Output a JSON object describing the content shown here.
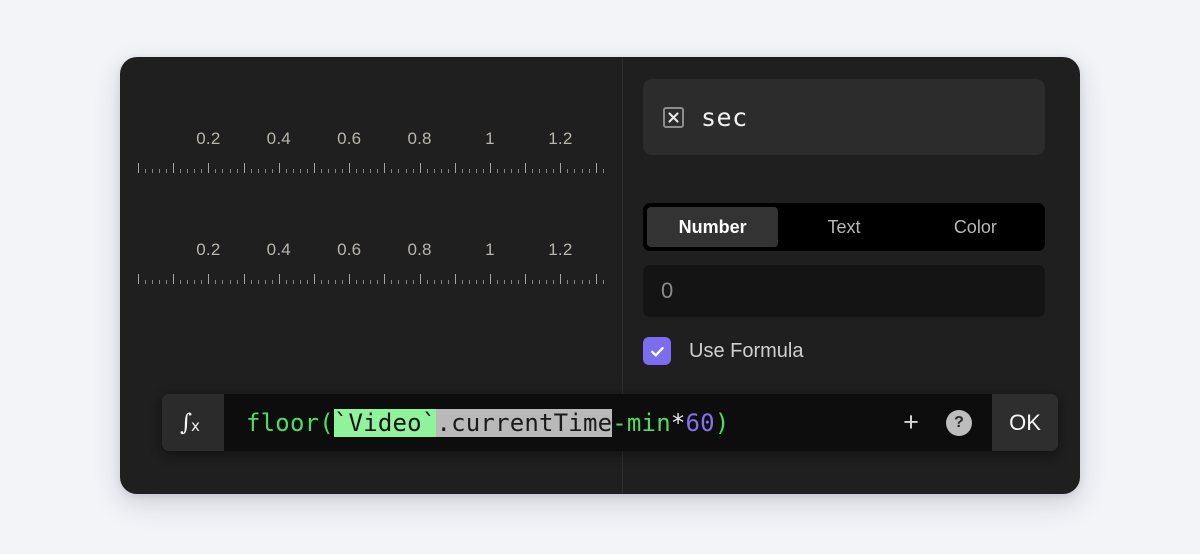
{
  "page": {
    "background_color": "#f3f4f8",
    "card_background": "#1f1f1f"
  },
  "left_pane": {
    "rulers": [
      {
        "name": "ruler-top",
        "tick_labels": [
          "0.2",
          "0.4",
          "0.6",
          "0.8",
          "1",
          "1.2"
        ],
        "minor_tick_step": 0.02,
        "major_tick_step": 0.1,
        "range_start": 0.0,
        "range_end": 1.32
      },
      {
        "name": "ruler-bottom",
        "tick_labels": [
          "0.2",
          "0.4",
          "0.6",
          "0.8",
          "1",
          "1.2"
        ],
        "minor_tick_step": 0.02,
        "major_tick_step": 0.1,
        "range_start": 0.0,
        "range_end": 1.32
      }
    ]
  },
  "right_pane": {
    "unit_field": {
      "icon": "boxed-x-icon",
      "label": "sec"
    },
    "type_tabs": {
      "options": [
        "Number",
        "Text",
        "Color"
      ],
      "active": "Number",
      "active_background": "#333333"
    },
    "value_field": {
      "value": "0"
    },
    "use_formula": {
      "label": "Use Formula",
      "checked": true,
      "accent_color": "#7c6cf0",
      "check_icon": "checkmark-icon"
    }
  },
  "formula_bar": {
    "fx_icon": "function-fx-icon",
    "expression": "floor(`Video`.currentTime-min*60)",
    "tokens": [
      {
        "text": "floor",
        "style": "fn"
      },
      {
        "text": "(",
        "style": "paren"
      },
      {
        "text": "`Video`",
        "style": "ref-highlight"
      },
      {
        "text": ".currentTime",
        "style": "selection"
      },
      {
        "text": "-min",
        "style": "op"
      },
      {
        "text": "*",
        "style": "star"
      },
      {
        "text": "60",
        "style": "num"
      },
      {
        "text": ")",
        "style": "paren"
      }
    ],
    "add_button_label": "+",
    "help_button_label": "?",
    "ok_button_label": "OK",
    "colors": {
      "function": "#4ddc63",
      "number": "#8470f0",
      "reference_highlight_bg": "#8ef39a",
      "selection_bg": "#b9b9b9"
    }
  }
}
